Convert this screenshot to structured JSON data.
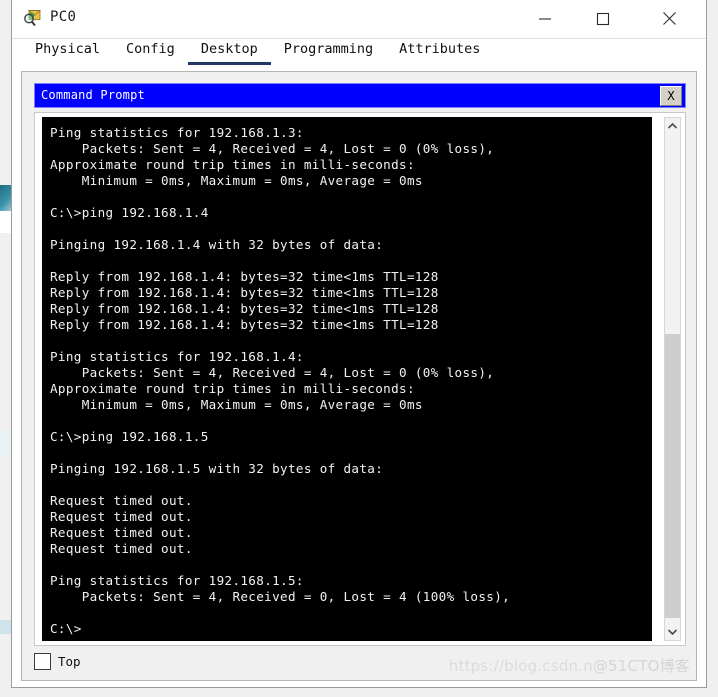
{
  "window": {
    "title": "PC0",
    "icon": "packet-tracer-icon",
    "controls": {
      "minimize": "minimize-icon",
      "maximize": "maximize-icon",
      "close": "close-icon"
    }
  },
  "tabs": [
    {
      "label": "Physical",
      "active": false
    },
    {
      "label": "Config",
      "active": false
    },
    {
      "label": "Desktop",
      "active": true
    },
    {
      "label": "Programming",
      "active": false
    },
    {
      "label": "Attributes",
      "active": false
    }
  ],
  "command_prompt": {
    "title": "Command Prompt",
    "close_label": "X",
    "title_bg": "#0000ff",
    "title_fg": "#ffffff",
    "terminal_bg": "#000000",
    "terminal_fg": "#f2f2f2",
    "lines": [
      "Ping statistics for 192.168.1.3:",
      "    Packets: Sent = 4, Received = 4, Lost = 0 (0% loss),",
      "Approximate round trip times in milli-seconds:",
      "    Minimum = 0ms, Maximum = 0ms, Average = 0ms",
      "",
      "C:\\>ping 192.168.1.4",
      "",
      "Pinging 192.168.1.4 with 32 bytes of data:",
      "",
      "Reply from 192.168.1.4: bytes=32 time<1ms TTL=128",
      "Reply from 192.168.1.4: bytes=32 time<1ms TTL=128",
      "Reply from 192.168.1.4: bytes=32 time<1ms TTL=128",
      "Reply from 192.168.1.4: bytes=32 time<1ms TTL=128",
      "",
      "Ping statistics for 192.168.1.4:",
      "    Packets: Sent = 4, Received = 4, Lost = 0 (0% loss),",
      "Approximate round trip times in milli-seconds:",
      "    Minimum = 0ms, Maximum = 0ms, Average = 0ms",
      "",
      "C:\\>ping 192.168.1.5",
      "",
      "Pinging 192.168.1.5 with 32 bytes of data:",
      "",
      "Request timed out.",
      "Request timed out.",
      "Request timed out.",
      "Request timed out.",
      "",
      "Ping statistics for 192.168.1.5:",
      "    Packets: Sent = 4, Received = 0, Lost = 4 (100% loss),",
      "",
      "C:\\>"
    ]
  },
  "scrollbar": {
    "up_icon": "chevron-up-icon",
    "down_icon": "chevron-down-icon"
  },
  "bottom": {
    "top_checkbox_label": "Top",
    "top_checkbox_checked": false
  },
  "watermark": {
    "url_text": "https://blog.csdn.n",
    "brand_text": "@51CTO博客"
  }
}
